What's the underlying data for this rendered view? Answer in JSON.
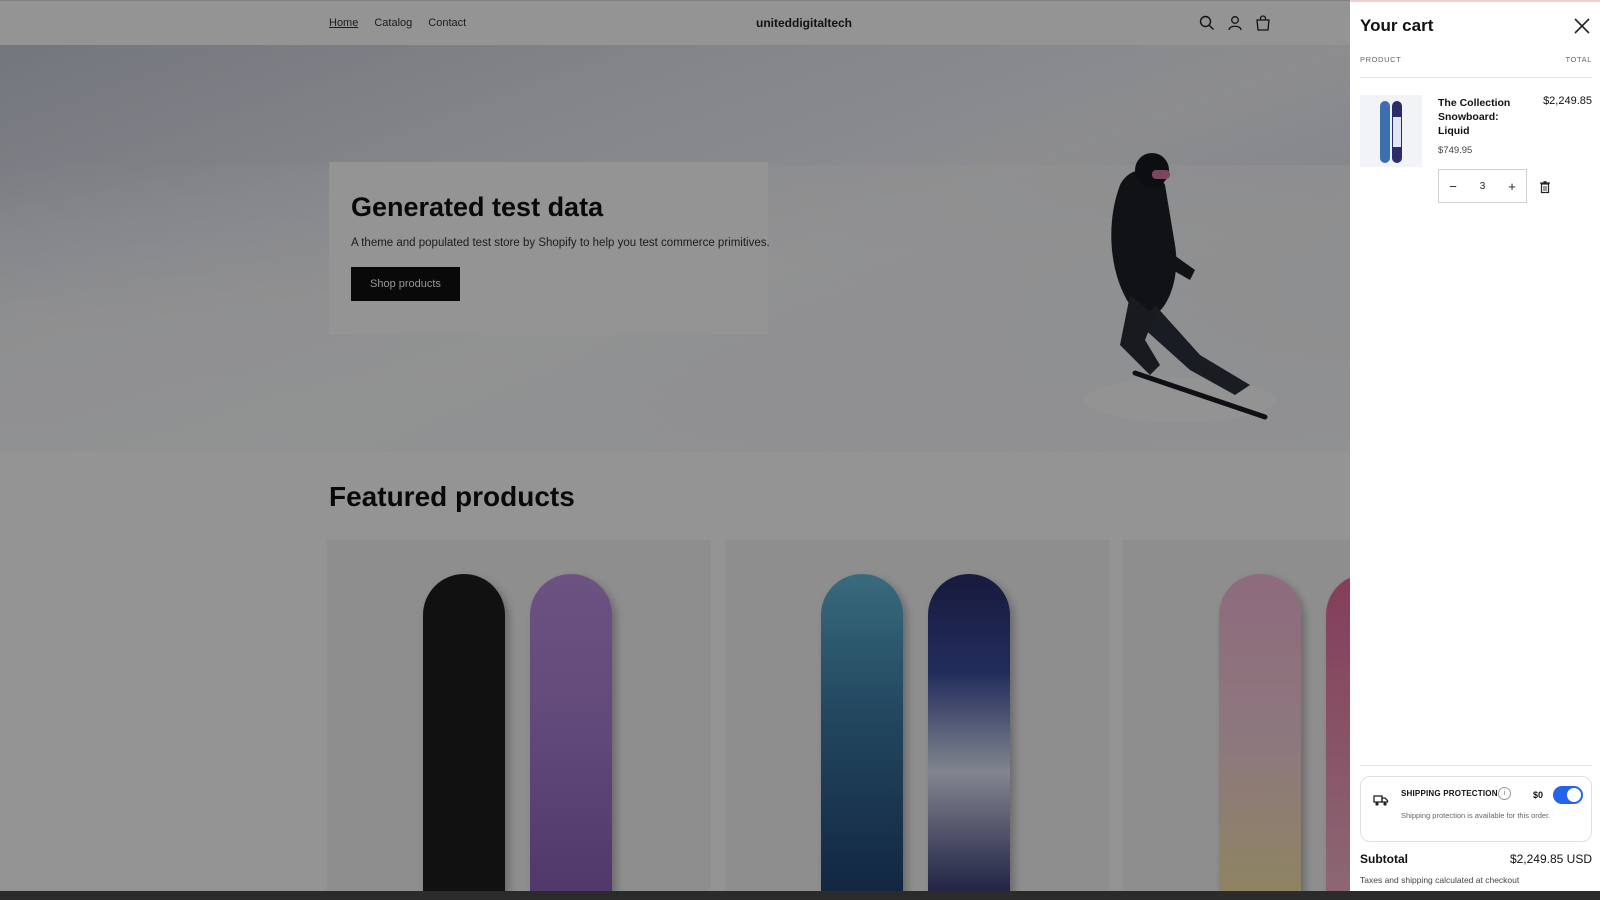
{
  "store": {
    "brand": "uniteddigitaltech",
    "nav": [
      "Home",
      "Catalog",
      "Contact"
    ],
    "cart_count": "3"
  },
  "hero": {
    "title": "Generated test data",
    "subtitle": "A theme and populated test store by Shopify to help you test commerce primitives.",
    "cta": "Shop products"
  },
  "featured": {
    "title": "Featured products"
  },
  "cart": {
    "title": "Your cart",
    "col_product": "PRODUCT",
    "col_total": "TOTAL",
    "item": {
      "title": "The Collection Snowboard: Liquid",
      "unit_price": "$749.95",
      "line_total": "$2,249.85",
      "quantity": "3"
    },
    "shipping": {
      "title": "SHIPPING PROTECTION",
      "price": "$0",
      "description": "Shipping protection is available for this order.",
      "enabled": true
    },
    "subtotal_label": "Subtotal",
    "subtotal_value": "$2,249.85 USD",
    "tax_note": "Taxes and shipping calculated at checkout"
  },
  "colors": {
    "accent": "#2563eb",
    "button": "#111111"
  }
}
